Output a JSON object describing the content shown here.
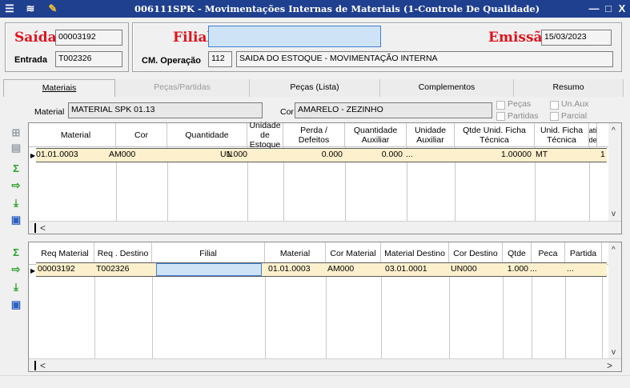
{
  "window": {
    "title": "006111SPK - Movimentações Internas de Materiais (1-Controle De Qualidade)",
    "minimize": "—",
    "maximize": "□",
    "close": "X"
  },
  "header": {
    "saida_label": "Saída",
    "saida_value": "00003192",
    "entrada_label": "Entrada",
    "entrada_value": "T002326",
    "filial_label": "Filial",
    "filial_value": "",
    "emissao_label": "Emissão",
    "emissao_value": "15/03/2023",
    "cm_operacao_label": "CM. Operação",
    "cm_operacao_code": "112",
    "cm_operacao_desc": "SAIDA DO ESTOQUE - MOVIMENTAÇÃO INTERNA"
  },
  "tabs": [
    {
      "label": "Materiais",
      "state": "active"
    },
    {
      "label": "Peças/Partidas",
      "state": "disabled"
    },
    {
      "label": "Peças (Lista)",
      "state": "normal"
    },
    {
      "label": "Complementos",
      "state": "normal"
    },
    {
      "label": "Resumo",
      "state": "normal"
    }
  ],
  "filters": {
    "material_label": "Material",
    "material_value": "MATERIAL SPK 01.13",
    "cor_label": "Cor",
    "cor_value": "AMARELO - ZEZINHO",
    "pecas_label": "Peças",
    "partidas_label": "Partidas",
    "unaux_label": "Un.Aux",
    "parcial_label": "Parcial"
  },
  "grid1": {
    "headers": [
      "Material",
      "Cor",
      "Quantidade",
      "Unidade de Estoque",
      "Perda / Defeitos",
      "Quantidade Auxiliar",
      "Unidade Auxiliar",
      "Qtde Unid. Ficha Técnica",
      "Unid. Ficha Técnica",
      "ati de"
    ],
    "row": [
      "01.01.0003",
      "AM000",
      "1.000",
      "UN",
      "0.000",
      "0.000",
      "...",
      "1.00000",
      "MT",
      "1"
    ]
  },
  "grid2": {
    "headers": [
      "Req Material",
      "Req . Destino",
      "Filial",
      "Material",
      "Cor Material",
      "Material Destino",
      "Cor Destino",
      "Qtde",
      "Peca",
      "Partida"
    ],
    "row": [
      "00003192",
      "T002326",
      "",
      "01.01.0003",
      "AM000",
      "03.01.0001",
      "UN000",
      "1.000",
      "...",
      "..."
    ]
  },
  "icons": {
    "app": "menu-icon",
    "tools": "wrench-icon",
    "sum": "Σ"
  },
  "colors": {
    "title_bar": "#1f3f8f",
    "label_red": "#e0141e",
    "row_highlight": "#fdf0cc",
    "filial_field": "#cfe3f7"
  }
}
